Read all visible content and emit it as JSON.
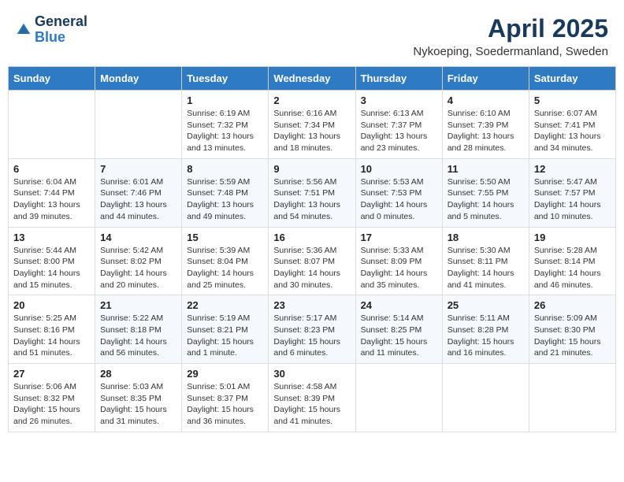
{
  "header": {
    "logo_general": "General",
    "logo_blue": "Blue",
    "month_year": "April 2025",
    "location": "Nykoeping, Soedermanland, Sweden"
  },
  "days_of_week": [
    "Sunday",
    "Monday",
    "Tuesday",
    "Wednesday",
    "Thursday",
    "Friday",
    "Saturday"
  ],
  "weeks": [
    [
      {
        "day": "",
        "info": ""
      },
      {
        "day": "",
        "info": ""
      },
      {
        "day": "1",
        "info": "Sunrise: 6:19 AM\nSunset: 7:32 PM\nDaylight: 13 hours\nand 13 minutes."
      },
      {
        "day": "2",
        "info": "Sunrise: 6:16 AM\nSunset: 7:34 PM\nDaylight: 13 hours\nand 18 minutes."
      },
      {
        "day": "3",
        "info": "Sunrise: 6:13 AM\nSunset: 7:37 PM\nDaylight: 13 hours\nand 23 minutes."
      },
      {
        "day": "4",
        "info": "Sunrise: 6:10 AM\nSunset: 7:39 PM\nDaylight: 13 hours\nand 28 minutes."
      },
      {
        "day": "5",
        "info": "Sunrise: 6:07 AM\nSunset: 7:41 PM\nDaylight: 13 hours\nand 34 minutes."
      }
    ],
    [
      {
        "day": "6",
        "info": "Sunrise: 6:04 AM\nSunset: 7:44 PM\nDaylight: 13 hours\nand 39 minutes."
      },
      {
        "day": "7",
        "info": "Sunrise: 6:01 AM\nSunset: 7:46 PM\nDaylight: 13 hours\nand 44 minutes."
      },
      {
        "day": "8",
        "info": "Sunrise: 5:59 AM\nSunset: 7:48 PM\nDaylight: 13 hours\nand 49 minutes."
      },
      {
        "day": "9",
        "info": "Sunrise: 5:56 AM\nSunset: 7:51 PM\nDaylight: 13 hours\nand 54 minutes."
      },
      {
        "day": "10",
        "info": "Sunrise: 5:53 AM\nSunset: 7:53 PM\nDaylight: 14 hours\nand 0 minutes."
      },
      {
        "day": "11",
        "info": "Sunrise: 5:50 AM\nSunset: 7:55 PM\nDaylight: 14 hours\nand 5 minutes."
      },
      {
        "day": "12",
        "info": "Sunrise: 5:47 AM\nSunset: 7:57 PM\nDaylight: 14 hours\nand 10 minutes."
      }
    ],
    [
      {
        "day": "13",
        "info": "Sunrise: 5:44 AM\nSunset: 8:00 PM\nDaylight: 14 hours\nand 15 minutes."
      },
      {
        "day": "14",
        "info": "Sunrise: 5:42 AM\nSunset: 8:02 PM\nDaylight: 14 hours\nand 20 minutes."
      },
      {
        "day": "15",
        "info": "Sunrise: 5:39 AM\nSunset: 8:04 PM\nDaylight: 14 hours\nand 25 minutes."
      },
      {
        "day": "16",
        "info": "Sunrise: 5:36 AM\nSunset: 8:07 PM\nDaylight: 14 hours\nand 30 minutes."
      },
      {
        "day": "17",
        "info": "Sunrise: 5:33 AM\nSunset: 8:09 PM\nDaylight: 14 hours\nand 35 minutes."
      },
      {
        "day": "18",
        "info": "Sunrise: 5:30 AM\nSunset: 8:11 PM\nDaylight: 14 hours\nand 41 minutes."
      },
      {
        "day": "19",
        "info": "Sunrise: 5:28 AM\nSunset: 8:14 PM\nDaylight: 14 hours\nand 46 minutes."
      }
    ],
    [
      {
        "day": "20",
        "info": "Sunrise: 5:25 AM\nSunset: 8:16 PM\nDaylight: 14 hours\nand 51 minutes."
      },
      {
        "day": "21",
        "info": "Sunrise: 5:22 AM\nSunset: 8:18 PM\nDaylight: 14 hours\nand 56 minutes."
      },
      {
        "day": "22",
        "info": "Sunrise: 5:19 AM\nSunset: 8:21 PM\nDaylight: 15 hours\nand 1 minute."
      },
      {
        "day": "23",
        "info": "Sunrise: 5:17 AM\nSunset: 8:23 PM\nDaylight: 15 hours\nand 6 minutes."
      },
      {
        "day": "24",
        "info": "Sunrise: 5:14 AM\nSunset: 8:25 PM\nDaylight: 15 hours\nand 11 minutes."
      },
      {
        "day": "25",
        "info": "Sunrise: 5:11 AM\nSunset: 8:28 PM\nDaylight: 15 hours\nand 16 minutes."
      },
      {
        "day": "26",
        "info": "Sunrise: 5:09 AM\nSunset: 8:30 PM\nDaylight: 15 hours\nand 21 minutes."
      }
    ],
    [
      {
        "day": "27",
        "info": "Sunrise: 5:06 AM\nSunset: 8:32 PM\nDaylight: 15 hours\nand 26 minutes."
      },
      {
        "day": "28",
        "info": "Sunrise: 5:03 AM\nSunset: 8:35 PM\nDaylight: 15 hours\nand 31 minutes."
      },
      {
        "day": "29",
        "info": "Sunrise: 5:01 AM\nSunset: 8:37 PM\nDaylight: 15 hours\nand 36 minutes."
      },
      {
        "day": "30",
        "info": "Sunrise: 4:58 AM\nSunset: 8:39 PM\nDaylight: 15 hours\nand 41 minutes."
      },
      {
        "day": "",
        "info": ""
      },
      {
        "day": "",
        "info": ""
      },
      {
        "day": "",
        "info": ""
      }
    ]
  ]
}
